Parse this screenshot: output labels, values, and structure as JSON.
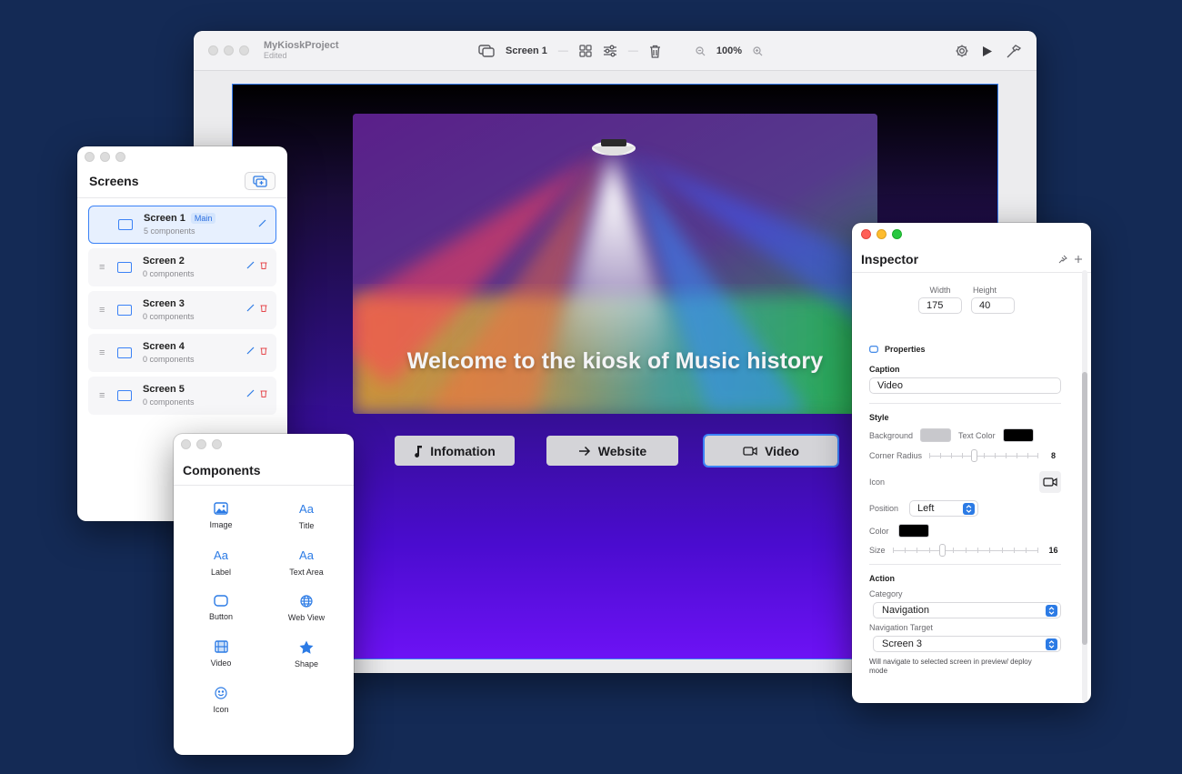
{
  "project": {
    "name": "MyKioskProject",
    "status": "Edited"
  },
  "toolbar": {
    "screen_name": "Screen 1",
    "zoom": "100%"
  },
  "canvas": {
    "hero_title": "Welcome to the kiosk of Music history",
    "buttons": [
      {
        "label": "Infomation",
        "icon": "music-note-icon"
      },
      {
        "label": "Website",
        "icon": "arrow-right-icon"
      },
      {
        "label": "Video",
        "icon": "video-camera-icon",
        "selected": true
      }
    ]
  },
  "screens_panel": {
    "title": "Screens",
    "items": [
      {
        "name": "Screen 1",
        "badge": "Main",
        "count": "5 components",
        "active": true
      },
      {
        "name": "Screen 2",
        "count": "0 components"
      },
      {
        "name": "Screen 3",
        "count": "0 components"
      },
      {
        "name": "Screen 4",
        "count": "0 components"
      },
      {
        "name": "Screen 5",
        "count": "0 components"
      }
    ]
  },
  "components_panel": {
    "title": "Components",
    "items": [
      {
        "label": "Image",
        "icon": "image-icon"
      },
      {
        "label": "Title",
        "icon": "title-aa-icon",
        "glyph": "Aa"
      },
      {
        "label": "Label",
        "icon": "label-aa-icon",
        "glyph": "Aa"
      },
      {
        "label": "Text Area",
        "icon": "textarea-aa-icon",
        "glyph": "Aa"
      },
      {
        "label": "Button",
        "icon": "button-icon"
      },
      {
        "label": "Web View",
        "icon": "globe-icon"
      },
      {
        "label": "Video",
        "icon": "film-icon"
      },
      {
        "label": "Shape",
        "icon": "star-icon"
      },
      {
        "label": "Icon",
        "icon": "smiley-icon"
      }
    ]
  },
  "inspector": {
    "title": "Inspector",
    "size": {
      "width_label": "Width",
      "height_label": "Height",
      "width": "175",
      "height": "40"
    },
    "properties": {
      "header": "Properties",
      "caption_label": "Caption",
      "caption_value": "Video"
    },
    "style": {
      "header": "Style",
      "background_label": "Background",
      "background_color": "#c8c8cc",
      "text_color_label": "Text Color",
      "text_color": "#000000",
      "corner_radius_label": "Corner Radius",
      "corner_radius": "8",
      "icon_label": "Icon",
      "position_label": "Position",
      "position_value": "Left",
      "color_label": "Color",
      "icon_color": "#000000",
      "size_label": "Size",
      "size_value": "16"
    },
    "action": {
      "header": "Action",
      "category_label": "Category",
      "category_value": "Navigation",
      "target_label": "Navigation Target",
      "target_value": "Screen 3",
      "note": "Will navigate to selected screen in preview/ deploy mode"
    }
  },
  "colors": {
    "accent": "#2c7be5",
    "background": "#142a55",
    "delete": "#e5484d"
  }
}
